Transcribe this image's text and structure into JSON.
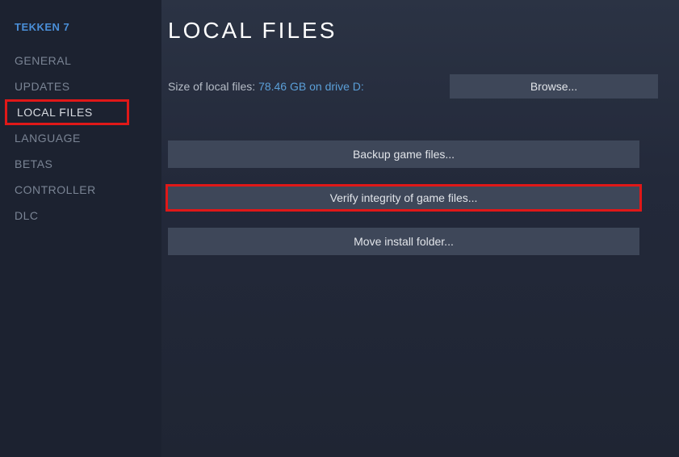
{
  "sidebar": {
    "game_title": "TEKKEN 7",
    "items": [
      {
        "label": "GENERAL"
      },
      {
        "label": "UPDATES"
      },
      {
        "label": "LOCAL FILES"
      },
      {
        "label": "LANGUAGE"
      },
      {
        "label": "BETAS"
      },
      {
        "label": "CONTROLLER"
      },
      {
        "label": "DLC"
      }
    ]
  },
  "main": {
    "title": "LOCAL FILES",
    "size_label": "Size of local files: ",
    "size_value": "78.46 GB on drive D:",
    "browse_label": "Browse...",
    "backup_label": "Backup game files...",
    "verify_label": "Verify integrity of game files...",
    "move_label": "Move install folder..."
  }
}
